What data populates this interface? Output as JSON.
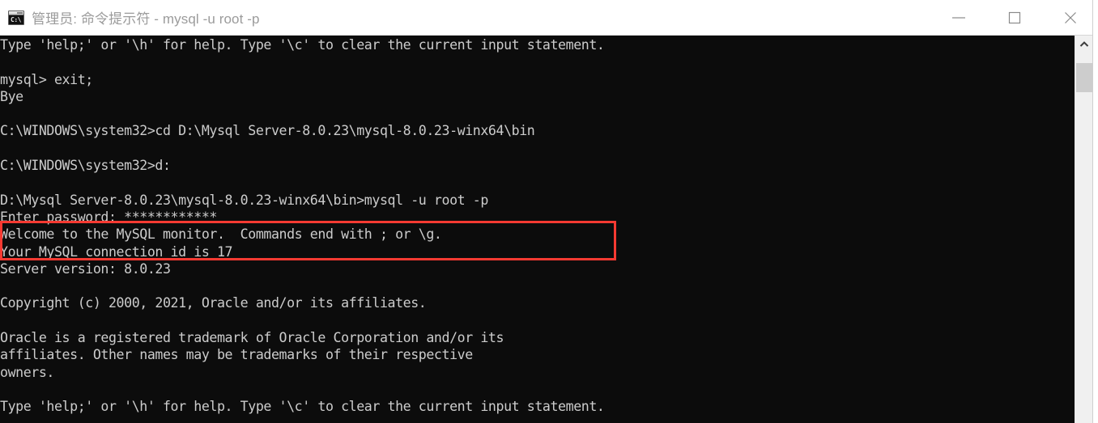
{
  "window": {
    "title": "管理员: 命令提示符 - mysql  -u root -p",
    "icon_label": "cmd-console-icon",
    "icon_prompt_glyph": "C:\\",
    "background_color": "#0c0c0c",
    "text_color": "#cccccc",
    "titlebar_color": "#ffffff",
    "title_text_color": "#9b9b9b"
  },
  "titlebar_buttons": {
    "minimize": "minimize",
    "maximize": "maximize",
    "close": "close"
  },
  "console": {
    "lines": [
      "Type 'help;' or '\\h' for help. Type '\\c' to clear the current input statement.",
      "",
      "mysql> exit;",
      "Bye",
      "",
      "C:\\WINDOWS\\system32>cd D:\\Mysql Server-8.0.23\\mysql-8.0.23-winx64\\bin",
      "",
      "C:\\WINDOWS\\system32>d:",
      "",
      "D:\\Mysql Server-8.0.23\\mysql-8.0.23-winx64\\bin>mysql -u root -p",
      "Enter password: ************",
      "Welcome to the MySQL monitor.  Commands end with ; or \\g.",
      "Your MySQL connection id is 17",
      "Server version: 8.0.23",
      "",
      "Copyright (c) 2000, 2021, Oracle and/or its affiliates.",
      "",
      "Oracle is a registered trademark of Oracle Corporation and/or its",
      "affiliates. Other names may be trademarks of their respective",
      "owners.",
      "",
      "Type 'help;' or '\\h' for help. Type '\\c' to clear the current input statement."
    ]
  },
  "annotation": {
    "color": "#f63a32",
    "highlighted_lines": [
      "D:\\Mysql Server-8.0.23\\mysql-8.0.23-winx64\\bin>mysql -u root -p",
      "Enter password: ************"
    ]
  },
  "scrollbar": {
    "up_arrow": "scroll-up",
    "thumb_label": "scroll-thumb"
  }
}
